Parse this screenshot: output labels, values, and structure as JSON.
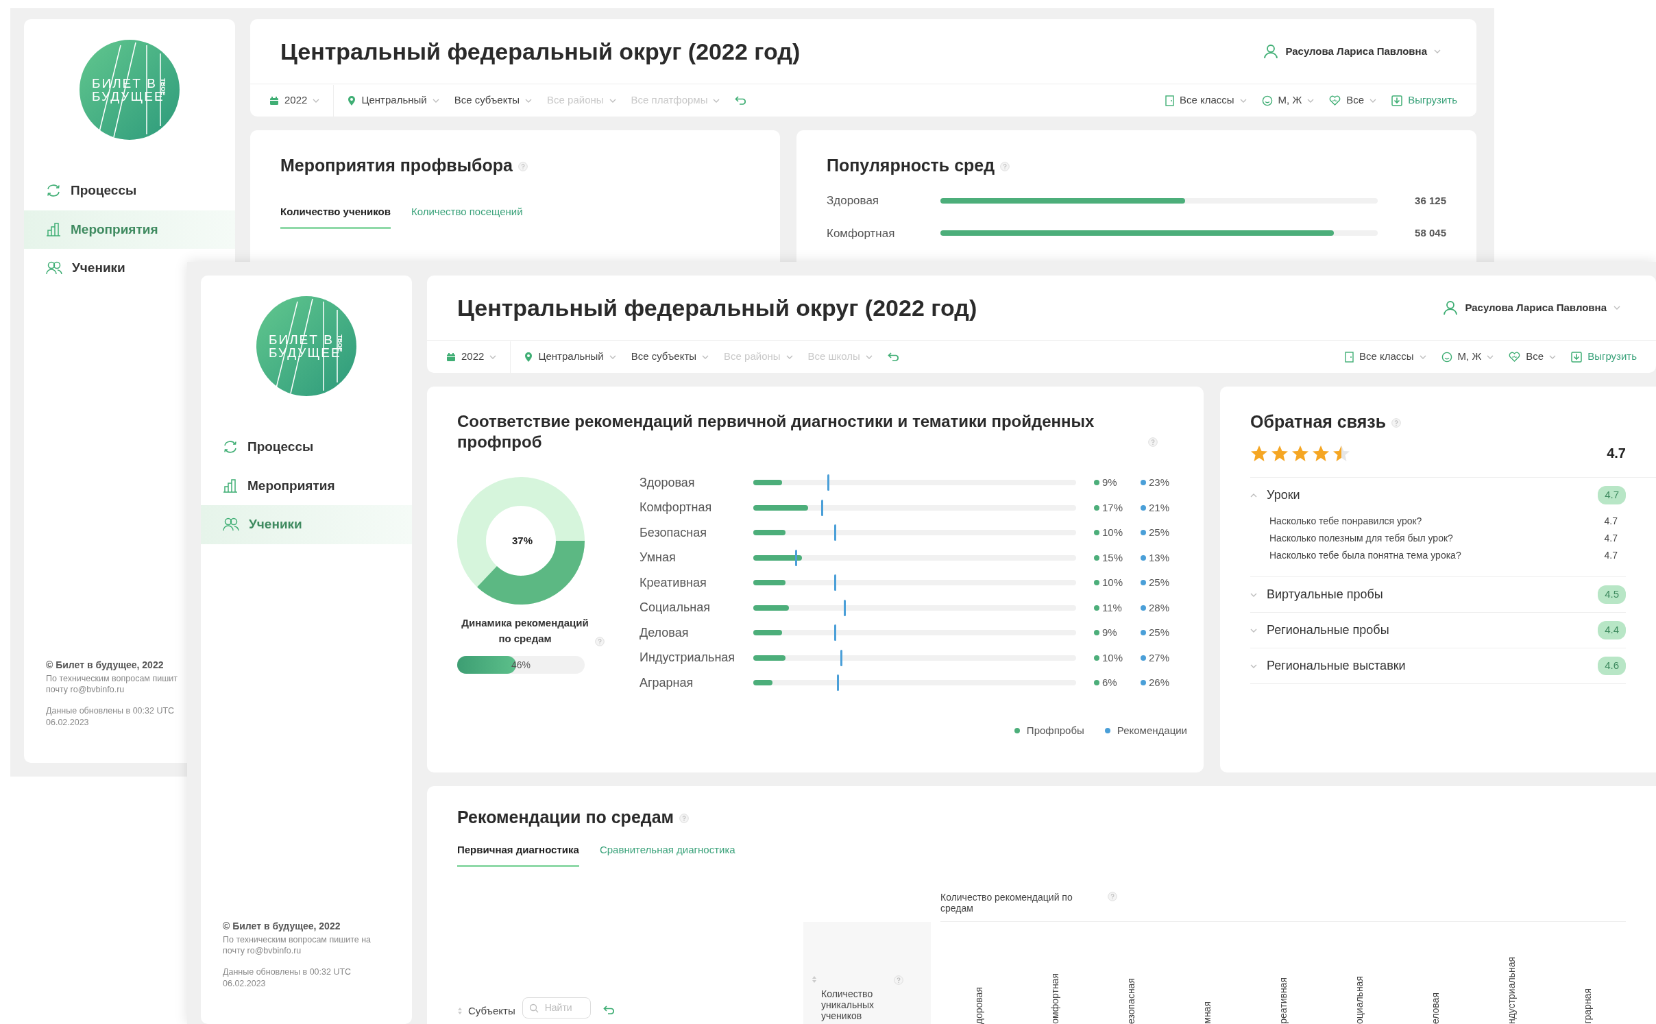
{
  "back_screen": {
    "sidebar": {
      "logo": {
        "line1": "БИЛЕТ В",
        "line2": "БУДУЩЕЕ",
        "tagline": "ТВОЕ"
      },
      "nav": [
        {
          "kind": "processes",
          "label": "Процессы",
          "selected": false
        },
        {
          "kind": "events",
          "label": "Мероприятия",
          "selected": true
        },
        {
          "kind": "students",
          "label": "Ученики",
          "selected": false
        }
      ],
      "footer": {
        "copyright": "© Билет в будущее, 2022",
        "support": [
          "По техническим вопросам пишит",
          "почту ro@bvbinfo.ru"
        ],
        "updated": [
          "Данные обновлены в 00:32 UTC",
          "06.02.2023"
        ]
      }
    },
    "header": {
      "title": "Центральный федеральный округ (2022 год)",
      "user": "Расулова Лариса Павловна",
      "filters": [
        {
          "kind": "year",
          "label": "2022",
          "disabled": false
        },
        {
          "kind": "region",
          "label": "Центральный",
          "disabled": false
        },
        {
          "kind": "select",
          "label": "Все субъекты",
          "disabled": false
        },
        {
          "kind": "select",
          "label": "Все районы",
          "disabled": true
        },
        {
          "kind": "select",
          "label": "Все платформы",
          "disabled": true
        }
      ],
      "actions": [
        {
          "kind": "classes",
          "label": "Все классы"
        },
        {
          "kind": "gender",
          "label": "М, Ж"
        },
        {
          "kind": "health",
          "label": "Все"
        },
        {
          "kind": "export",
          "label": "Выгрузить"
        }
      ]
    },
    "events_card": {
      "title": "Мероприятия профвыбора",
      "tabs": [
        {
          "label": "Количество учеников",
          "selected": true
        },
        {
          "label": "Количество посещений",
          "selected": false
        }
      ]
    },
    "popularity_card": {
      "title": "Популярность сред",
      "rows": [
        {
          "label": "Здоровая",
          "level": 0.56,
          "value": "36 125"
        },
        {
          "label": "Комфортная",
          "level": 0.9,
          "value": "58 045"
        }
      ]
    }
  },
  "front_screen": {
    "sidebar": {
      "logo": {
        "line1": "БИЛЕТ В",
        "line2": "БУДУЩЕЕ",
        "tagline": "ТВОЕ"
      },
      "nav": [
        {
          "kind": "processes",
          "label": "Процессы",
          "selected": false
        },
        {
          "kind": "events",
          "label": "Мероприятия",
          "selected": false
        },
        {
          "kind": "students",
          "label": "Ученики",
          "selected": true
        }
      ],
      "footer": {
        "copyright": "© Билет в будущее, 2022",
        "support": [
          "По техническим вопросам пишите на",
          "почту ro@bvbinfo.ru"
        ],
        "updated": [
          "Данные обновлены в 00:32 UTC",
          "06.02.2023"
        ]
      }
    },
    "header": {
      "title": "Центральный федеральный округ (2022 год)",
      "user": "Расулова Лариса Павловна",
      "filters": [
        {
          "kind": "year",
          "label": "2022",
          "disabled": false
        },
        {
          "kind": "region",
          "label": "Центральный",
          "disabled": false
        },
        {
          "kind": "select",
          "label": "Все субъекты",
          "disabled": false
        },
        {
          "kind": "select",
          "label": "Все районы",
          "disabled": true
        },
        {
          "kind": "select",
          "label": "Все школы",
          "disabled": true
        }
      ],
      "actions": [
        {
          "kind": "classes",
          "label": "Все классы"
        },
        {
          "kind": "gender",
          "label": "М, Ж"
        },
        {
          "kind": "health",
          "label": "Все"
        },
        {
          "kind": "export",
          "label": "Выгрузить"
        }
      ]
    },
    "match_card": {
      "title": "Соответствие рекомендаций первичной диагностики и тематики пройденных профпроб",
      "donut": {
        "level": 0.37,
        "label": "37%"
      },
      "dynamics": {
        "caption": "Динамика рекомендаций по средам",
        "level": 0.46,
        "label": "46%"
      },
      "legend": [
        {
          "label": "Профпробы",
          "color": "#4cae7a"
        },
        {
          "label": "Рекомендации",
          "color": "#4a9fd8"
        }
      ],
      "rows": [
        {
          "label": "Здоровая",
          "measures": [
            {
              "kind": "bar",
              "level": 0.09,
              "reading": "9%"
            },
            {
              "kind": "marker",
              "level": 0.23,
              "reading": "23%"
            }
          ]
        },
        {
          "label": "Комфортная",
          "measures": [
            {
              "kind": "bar",
              "level": 0.17,
              "reading": "17%"
            },
            {
              "kind": "marker",
              "level": 0.21,
              "reading": "21%"
            }
          ]
        },
        {
          "label": "Безопасная",
          "measures": [
            {
              "kind": "bar",
              "level": 0.1,
              "reading": "10%"
            },
            {
              "kind": "marker",
              "level": 0.25,
              "reading": "25%"
            }
          ]
        },
        {
          "label": "Умная",
          "measures": [
            {
              "kind": "bar",
              "level": 0.15,
              "reading": "15%"
            },
            {
              "kind": "marker",
              "level": 0.13,
              "reading": "13%"
            }
          ]
        },
        {
          "label": "Креативная",
          "measures": [
            {
              "kind": "bar",
              "level": 0.1,
              "reading": "10%"
            },
            {
              "kind": "marker",
              "level": 0.25,
              "reading": "25%"
            }
          ]
        },
        {
          "label": "Социальная",
          "measures": [
            {
              "kind": "bar",
              "level": 0.11,
              "reading": "11%"
            },
            {
              "kind": "marker",
              "level": 0.28,
              "reading": "28%"
            }
          ]
        },
        {
          "label": "Деловая",
          "measures": [
            {
              "kind": "bar",
              "level": 0.09,
              "reading": "9%"
            },
            {
              "kind": "marker",
              "level": 0.25,
              "reading": "25%"
            }
          ]
        },
        {
          "label": "Индустриальная",
          "measures": [
            {
              "kind": "bar",
              "level": 0.1,
              "reading": "10%"
            },
            {
              "kind": "marker",
              "level": 0.27,
              "reading": "27%"
            }
          ]
        },
        {
          "label": "Аграрная",
          "measures": [
            {
              "kind": "bar",
              "level": 0.06,
              "reading": "6%"
            },
            {
              "kind": "marker",
              "level": 0.26,
              "reading": "26%"
            }
          ]
        }
      ]
    },
    "feedback_card": {
      "title": "Обратная связь",
      "stars": 4.5,
      "score": "4.7",
      "sections": [
        {
          "title": "Уроки",
          "score": "4.7",
          "expanded": true,
          "questions": [
            {
              "text": "Насколько тебе понравился урок?",
              "score": "4.7"
            },
            {
              "text": "Насколько полезным для тебя был урок?",
              "score": "4.7"
            },
            {
              "text": "Насколько тебе была понятна тема урока?",
              "score": "4.7"
            }
          ]
        },
        {
          "title": "Виртуальные пробы",
          "score": "4.5",
          "expanded": false
        },
        {
          "title": "Региональные пробы",
          "score": "4.4",
          "expanded": false
        },
        {
          "title": "Региональные выставки",
          "score": "4.6",
          "expanded": false
        }
      ]
    },
    "recommendations_card": {
      "title": "Рекомендации по средам",
      "tabs": [
        {
          "label": "Первичная диагностика",
          "selected": true
        },
        {
          "label": "Сравнительная диагностика",
          "selected": false
        }
      ],
      "table": {
        "subjects_header": "Субъекты",
        "search": {
          "placeholder": "Найти"
        },
        "count_header": "Количество уникальных учеников",
        "group_header": "Количество рекомендаций по средам",
        "columns": [
          "доровая",
          "омфортная",
          "езопасная",
          "мная",
          "реативная",
          "оциальная",
          "еловая",
          "ндустриальная",
          "грарная"
        ]
      }
    }
  }
}
